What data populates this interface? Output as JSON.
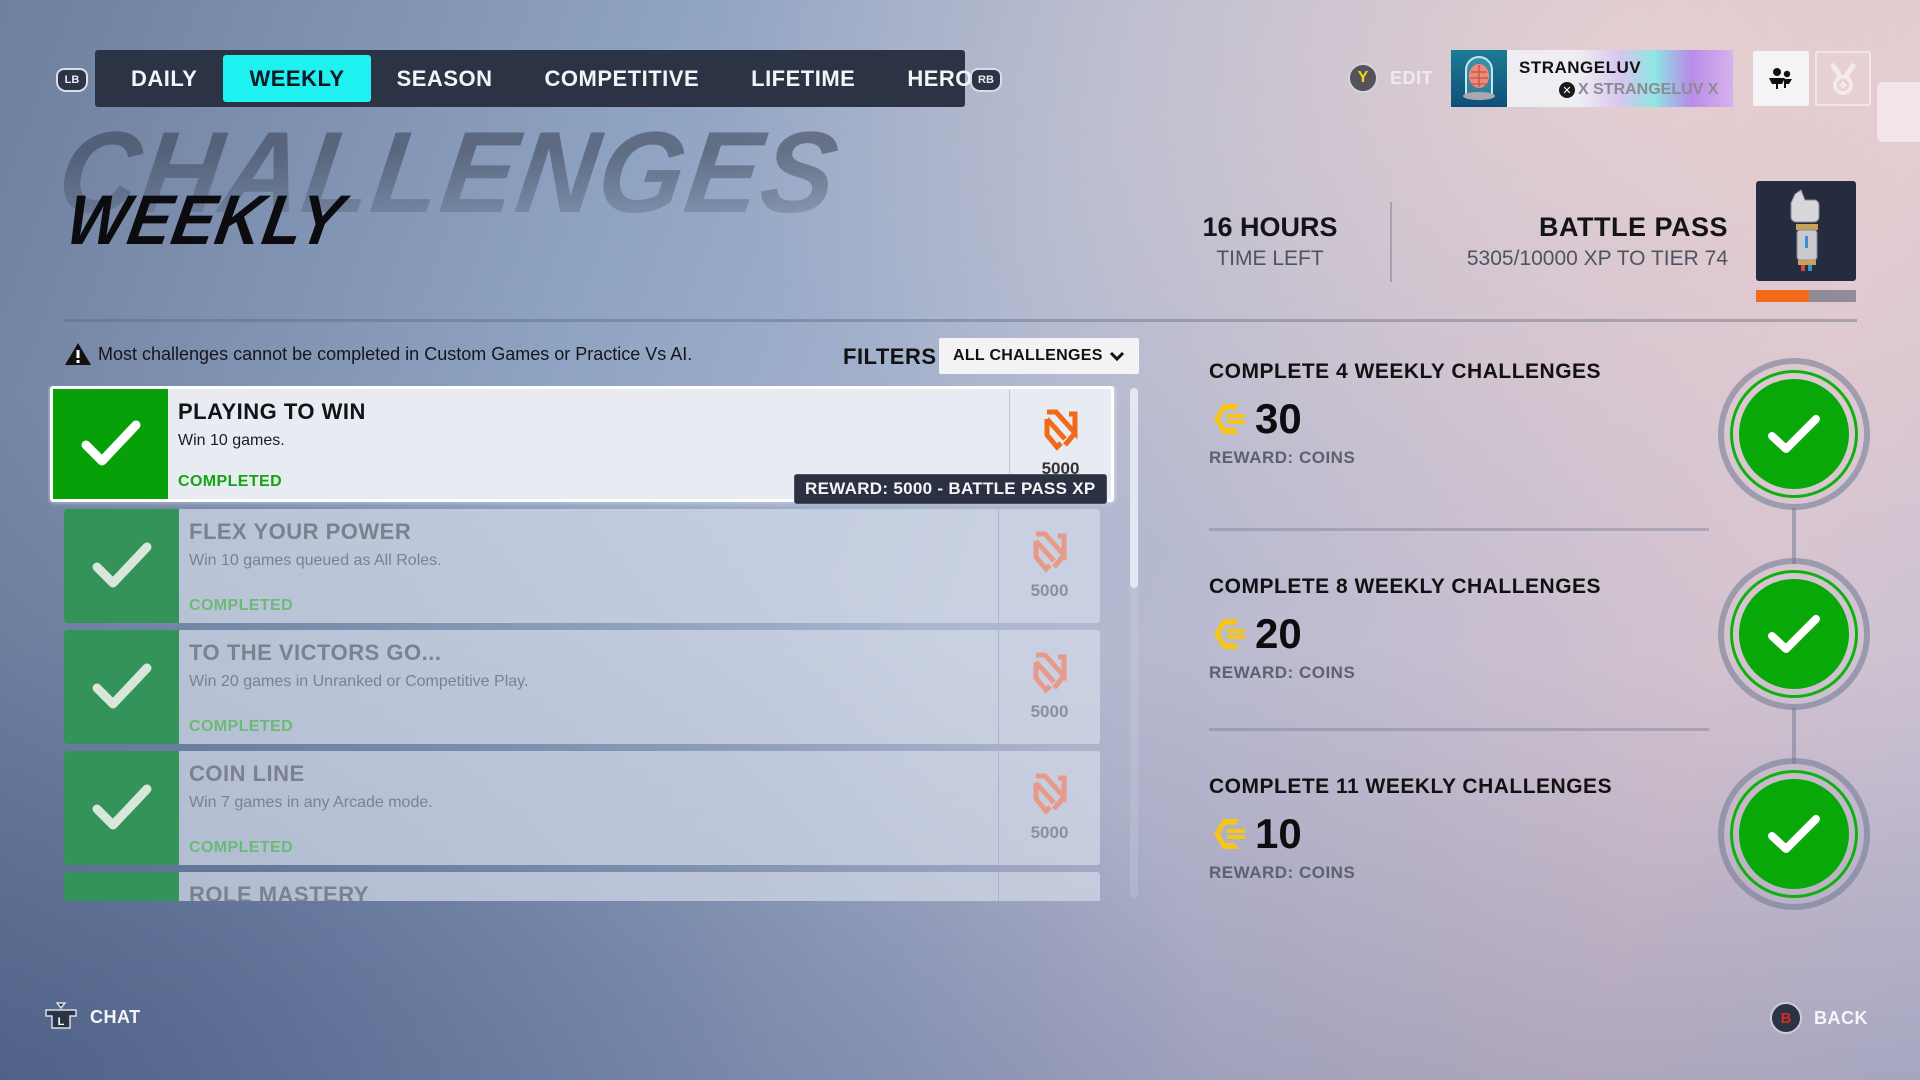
{
  "nav": {
    "left_bumper": "LB",
    "right_bumper": "RB",
    "tabs": [
      {
        "label": "DAILY",
        "active": false
      },
      {
        "label": "WEEKLY",
        "active": true
      },
      {
        "label": "SEASON",
        "active": false
      },
      {
        "label": "COMPETITIVE",
        "active": false
      },
      {
        "label": "LIFETIME",
        "active": false
      },
      {
        "label": "HERO",
        "active": false
      }
    ]
  },
  "header": {
    "edit_button_key": "Y",
    "edit_label": "EDIT",
    "player": {
      "name": "STRANGELUV",
      "platform_tag": "X STRANGELUV X",
      "platform_icon": "xbox-icon",
      "avatar_icon": "brain-in-jar-icon"
    },
    "social_icon": "group-icon",
    "badge_icon": "medal-icon"
  },
  "page": {
    "title_bg": "CHALLENGES",
    "title_fg": "WEEKLY"
  },
  "timer": {
    "value": "16 HOURS",
    "label": "TIME LEFT"
  },
  "battle_pass": {
    "title": "BATTLE PASS",
    "progress_text": "5305/10000 XP TO TIER 74",
    "progress_fraction": 0.53,
    "reward_icon": "thumbs-up-arm-icon",
    "colors": {
      "fill": "#f06a1a",
      "track": "#8f8c98"
    }
  },
  "notice": {
    "icon": "warning-icon",
    "text": "Most challenges cannot be completed in Custom Games or Practice Vs AI."
  },
  "filters": {
    "label": "FILTERS",
    "selected": "ALL CHALLENGES"
  },
  "challenges": [
    {
      "title": "PLAYING TO WIN",
      "description": "Win 10 games.",
      "status": "COMPLETED",
      "reward": "5000",
      "focused": true
    },
    {
      "title": "FLEX YOUR POWER",
      "description": "Win 10 games queued as All Roles.",
      "status": "COMPLETED",
      "reward": "5000",
      "focused": false
    },
    {
      "title": "TO THE VICTORS GO...",
      "description": "Win 20 games in Unranked or Competitive Play.",
      "status": "COMPLETED",
      "reward": "5000",
      "focused": false
    },
    {
      "title": "COIN LINE",
      "description": "Win 7 games in any Arcade mode.",
      "status": "COMPLETED",
      "reward": "5000",
      "focused": false
    },
    {
      "title": "ROLE MASTERY",
      "description": "",
      "status": "",
      "reward": "",
      "focused": false
    }
  ],
  "tooltip": {
    "text": "REWARD:  5000  -  BATTLE PASS XP"
  },
  "milestones": [
    {
      "title": "COMPLETE 4 WEEKLY CHALLENGES",
      "amount": "30",
      "reward_label": "REWARD:  COINS",
      "completed": true
    },
    {
      "title": "COMPLETE 8 WEEKLY CHALLENGES",
      "amount": "20",
      "reward_label": "REWARD:  COINS",
      "completed": true
    },
    {
      "title": "COMPLETE 11 WEEKLY CHALLENGES",
      "amount": "10",
      "reward_label": "REWARD:  COINS",
      "completed": true
    }
  ],
  "footer": {
    "chat_label": "CHAT",
    "chat_key": "L",
    "back_label": "BACK",
    "back_key": "B"
  },
  "colors": {
    "accent_tab": "#1ff0f0",
    "complete_green": "#08a808",
    "coin_gold": "#f5c518",
    "bp_xp_orange": "#f06a1a"
  }
}
